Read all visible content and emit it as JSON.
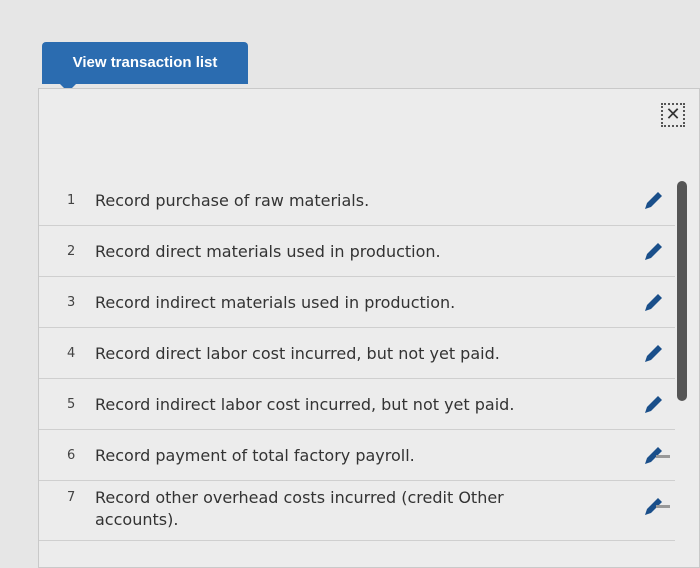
{
  "tab": {
    "label": "View transaction list"
  },
  "close": {
    "glyph": "✕"
  },
  "transactions": [
    {
      "num": "1",
      "text": "Record purchase of raw materials."
    },
    {
      "num": "2",
      "text": "Record direct materials used in production."
    },
    {
      "num": "3",
      "text": "Record indirect materials used in production."
    },
    {
      "num": "4",
      "text": "Record direct labor cost incurred, but not yet paid."
    },
    {
      "num": "5",
      "text": "Record indirect labor cost incurred, but not yet paid."
    },
    {
      "num": "6",
      "text": "Record payment of total factory payroll."
    },
    {
      "num": "7",
      "text": "Record other overhead costs incurred (credit Other accounts)."
    }
  ],
  "colors": {
    "accent": "#2b6cb0",
    "pencil": "#1a4f8a"
  },
  "icons": {
    "edit": "pencil-icon",
    "close": "close-icon"
  }
}
